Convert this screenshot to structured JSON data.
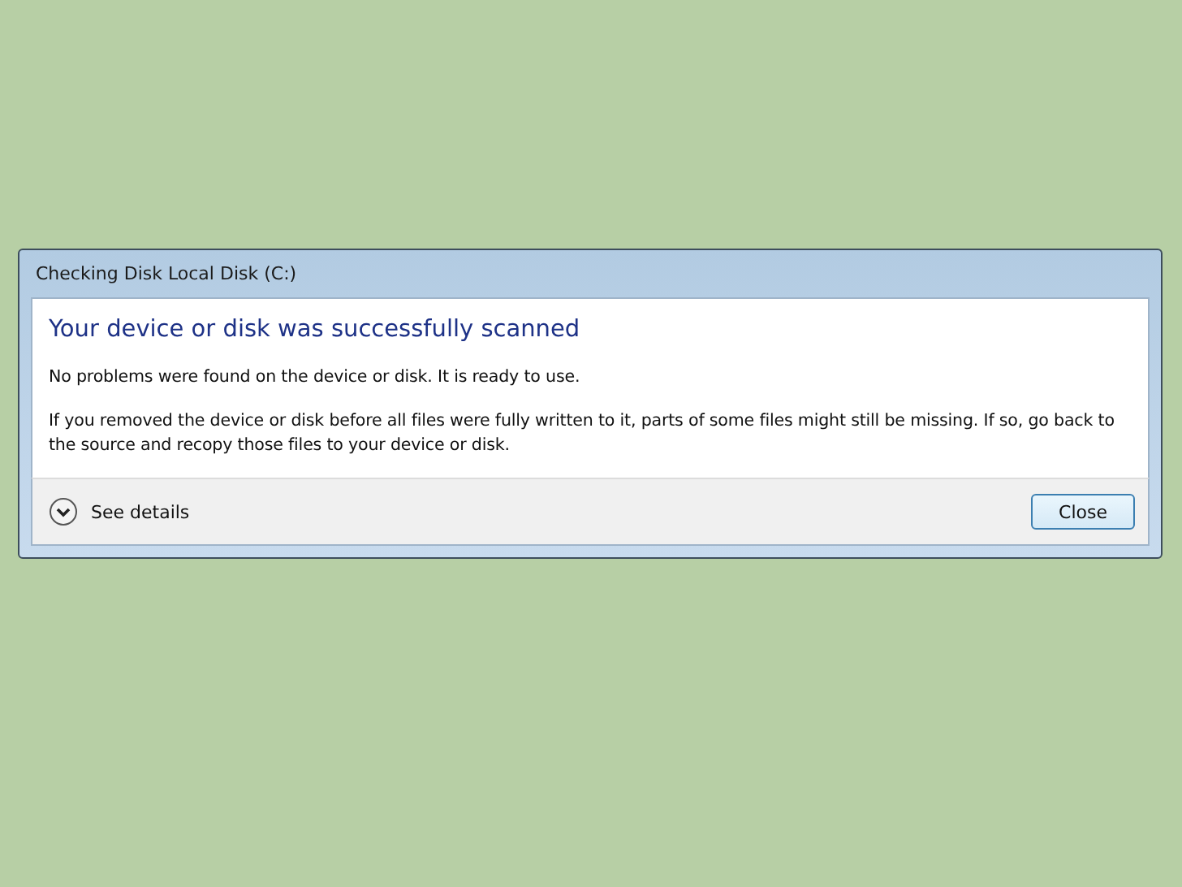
{
  "window": {
    "title": "Checking Disk Local Disk (C:)"
  },
  "heading": "Your device or disk was successfully scanned",
  "messages": [
    "No problems were found on the device or disk. It is ready to use.",
    "If you removed the device or disk before all files were fully written to it, parts of some files might still be missing. If so, go back to the source and recopy those files to your device or disk."
  ],
  "details": {
    "label": "See details",
    "expanded": false
  },
  "buttons": [
    "Close"
  ]
}
